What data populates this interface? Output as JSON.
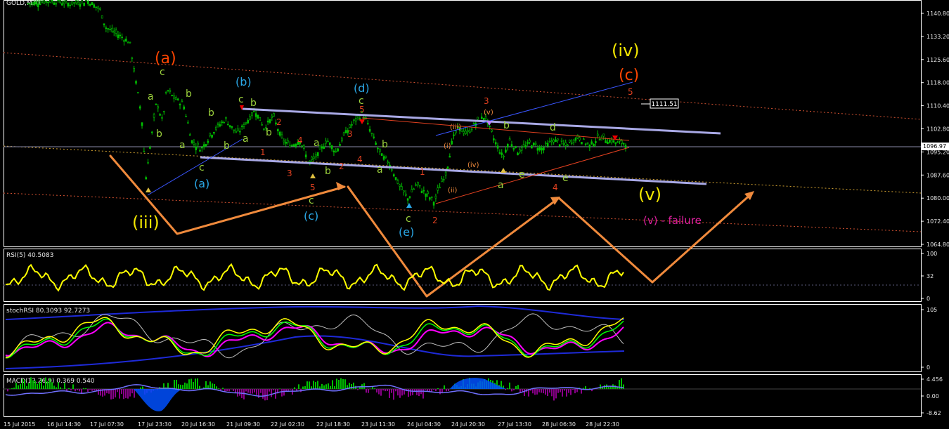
{
  "colors": {
    "background": "#000000",
    "frame": "#ffffff",
    "candles": "#00c000",
    "trend_channel": "#a9a9e6",
    "orange_arrow": "#f08a3c",
    "rsi_line": "#ffff00",
    "stoch_main": "#ffff00",
    "stoch_signal": "#ff00ff",
    "stoch_aux": "#00ff00",
    "bands": "#1e2ad8",
    "macd_pos": "#00c000",
    "macd_neg": "#8b008b",
    "macd_hist_fill": "#0050ff",
    "label_yellow": "#f2e600",
    "label_orange": "#ff4500",
    "label_cyan": "#2aa7e6",
    "label_red": "#e00000",
    "label_green": "#9bd13c",
    "label_magenta": "#e020a0"
  },
  "chart_data": [
    {
      "type": "line",
      "pane": "price",
      "title": "GOLD,M30",
      "ylim": [
        1062,
        1145
      ],
      "yticks": [
        "1140.80",
        "1133.20",
        "1125.60",
        "1118.00",
        "1110.40",
        "1102.80",
        "1095.20",
        "1087.60",
        "1080.00",
        "1072.40",
        "1064.80"
      ],
      "current_price": "1096.97",
      "marked_price": "1111.51",
      "x_labels": [
        "15 Jul 2015",
        "16 Jul 14:30",
        "17 Jul 07:30",
        "17 Jul 23:30",
        "20 Jul 16:30",
        "21 Jul 09:30",
        "22 Jul 02:30",
        "22 Jul 18:30",
        "23 Jul 11:30",
        "24 Jul 04:30",
        "24 Jul 20:30",
        "27 Jul 13:30",
        "28 Jul 06:30",
        "28 Jul 22:30"
      ],
      "price_path": [
        [
          0.0,
          1144
        ],
        [
          0.04,
          1145
        ],
        [
          0.07,
          1144
        ],
        [
          0.1,
          1145
        ],
        [
          0.12,
          1142
        ],
        [
          0.13,
          1136
        ],
        [
          0.155,
          1133
        ],
        [
          0.17,
          1131
        ],
        [
          0.18,
          1118
        ],
        [
          0.19,
          1106
        ],
        [
          0.197,
          1085
        ],
        [
          0.205,
          1097
        ],
        [
          0.215,
          1111
        ],
        [
          0.225,
          1104
        ],
        [
          0.232,
          1115
        ],
        [
          0.245,
          1112
        ],
        [
          0.26,
          1110
        ],
        [
          0.275,
          1097
        ],
        [
          0.29,
          1095
        ],
        [
          0.31,
          1101
        ],
        [
          0.33,
          1105
        ],
        [
          0.35,
          1100
        ],
        [
          0.365,
          1104
        ],
        [
          0.38,
          1108
        ],
        [
          0.395,
          1102
        ],
        [
          0.41,
          1106
        ],
        [
          0.425,
          1098
        ],
        [
          0.44,
          1096
        ],
        [
          0.455,
          1098
        ],
        [
          0.47,
          1090
        ],
        [
          0.485,
          1093
        ],
        [
          0.5,
          1098
        ],
        [
          0.515,
          1094
        ],
        [
          0.53,
          1100
        ],
        [
          0.545,
          1104
        ],
        [
          0.56,
          1107
        ],
        [
          0.575,
          1100
        ],
        [
          0.59,
          1093
        ],
        [
          0.605,
          1090
        ],
        [
          0.62,
          1083
        ],
        [
          0.635,
          1078
        ],
        [
          0.65,
          1083
        ],
        [
          0.665,
          1080
        ],
        [
          0.68,
          1077
        ],
        [
          0.69,
          1083
        ],
        [
          0.7,
          1087
        ],
        [
          0.71,
          1098
        ],
        [
          0.72,
          1102
        ],
        [
          0.735,
          1100
        ],
        [
          0.75,
          1104
        ],
        [
          0.765,
          1106
        ],
        [
          0.78,
          1098
        ],
        [
          0.795,
          1092
        ],
        [
          0.805,
          1098
        ],
        [
          0.82,
          1094
        ],
        [
          0.84,
          1097
        ],
        [
          0.86,
          1095
        ],
        [
          0.88,
          1098
        ],
        [
          0.9,
          1096
        ],
        [
          0.92,
          1099
        ],
        [
          0.94,
          1096
        ],
        [
          0.955,
          1099
        ],
        [
          0.97,
          1098
        ],
        [
          0.985,
          1097
        ],
        [
          1.0,
          1097
        ]
      ]
    },
    {
      "type": "line",
      "pane": "rsi",
      "title": "RSI(5) 40.5083",
      "ylim": [
        0,
        100
      ],
      "yticks": [
        "100",
        "32",
        "0"
      ],
      "level": 32
    },
    {
      "type": "line",
      "pane": "stoch",
      "title": "stochRSI 80.3093 92.7273",
      "ylim": [
        0,
        105
      ],
      "yticks": [
        "105",
        "0"
      ]
    },
    {
      "type": "bar",
      "pane": "macd",
      "title": "MACD(12,26,9) 0.369 0.540",
      "ylim": [
        -8.62,
        4.456
      ],
      "yticks": [
        "4.456",
        "0.00",
        "-8.62"
      ]
    }
  ],
  "wave_labels": [
    {
      "t": "(a)",
      "c": "label_orange",
      "s": 22
    },
    {
      "t": "(iii)",
      "c": "label_yellow",
      "s": 24
    },
    {
      "t": "(iv)",
      "c": "label_yellow",
      "s": 24
    },
    {
      "t": "(c)",
      "c": "label_orange",
      "s": 22
    },
    {
      "t": "(v)",
      "c": "label_yellow",
      "s": 24
    },
    {
      "t": "(v) - failure",
      "c": "label_magenta",
      "s": 15
    },
    {
      "t": "(b)",
      "c": "label_cyan",
      "s": 16
    },
    {
      "t": "(a)",
      "c": "label_cyan",
      "s": 16
    },
    {
      "t": "(c)",
      "c": "label_cyan",
      "s": 16
    },
    {
      "t": "(d)",
      "c": "label_cyan",
      "s": 16
    },
    {
      "t": "(e)",
      "c": "label_cyan",
      "s": 16
    },
    {
      "t": "5",
      "c": "label_red",
      "s": 12
    },
    {
      "t": "3",
      "c": "label_red",
      "s": 12
    },
    {
      "t": "4",
      "c": "label_red",
      "s": 12
    },
    {
      "t": "2",
      "c": "label_red",
      "s": 12
    },
    {
      "t": "1",
      "c": "label_red",
      "s": 12
    },
    {
      "t": "c",
      "c": "label_green",
      "s": 14
    },
    {
      "t": "a",
      "c": "label_green",
      "s": 14
    },
    {
      "t": "b",
      "c": "label_green",
      "s": 14
    },
    {
      "t": "d",
      "c": "label_green",
      "s": 14
    },
    {
      "t": "e",
      "c": "label_green",
      "s": 14
    },
    {
      "t": "(i)",
      "c": "label_orange",
      "s": 10
    },
    {
      "t": "(ii)",
      "c": "label_orange",
      "s": 10
    },
    {
      "t": "(iii)",
      "c": "label_orange",
      "s": 10
    },
    {
      "t": "(iv)",
      "c": "label_orange",
      "s": 10
    },
    {
      "t": "(v)",
      "c": "label_orange",
      "s": 10
    }
  ]
}
